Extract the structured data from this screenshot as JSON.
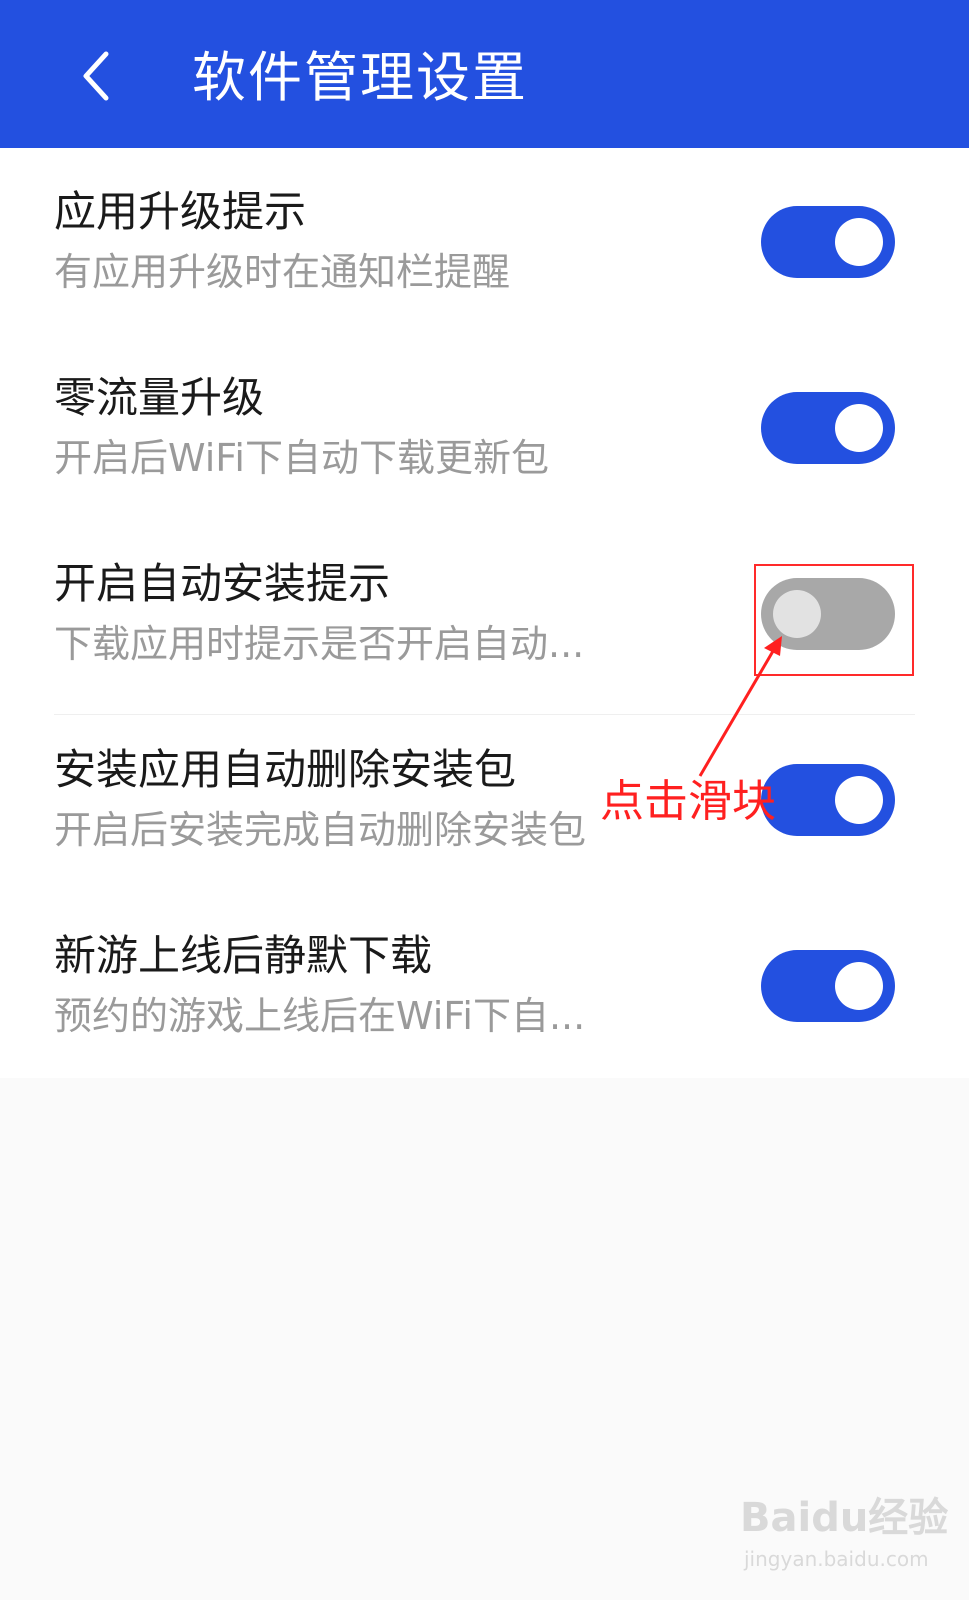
{
  "colors": {
    "header_bg": "#2350e0",
    "toggle_on": "#2350e0",
    "toggle_off": "#a8a8a8",
    "annotation": "#ff2020"
  },
  "header": {
    "back_icon": "chevron-left-icon",
    "title": "软件管理设置"
  },
  "settings": [
    {
      "title": "应用升级提示",
      "subtitle": "有应用升级时在通知栏提醒",
      "enabled": true
    },
    {
      "title": "零流量升级",
      "subtitle": "开启后WiFi下自动下载更新包",
      "enabled": true
    },
    {
      "title": "开启自动安装提示",
      "subtitle": "下载应用时提示是否开启自动...",
      "enabled": false
    },
    {
      "title": "安装应用自动删除安装包",
      "subtitle": "开启后安装完成自动删除安装包",
      "enabled": true
    },
    {
      "title": "新游上线后静默下载",
      "subtitle": "预约的游戏上线后在WiFi下自...",
      "enabled": true
    }
  ],
  "annotation": {
    "text": "点击滑块"
  },
  "watermark": {
    "brand": "Baidu经验",
    "url": "jingyan.baidu.com"
  }
}
